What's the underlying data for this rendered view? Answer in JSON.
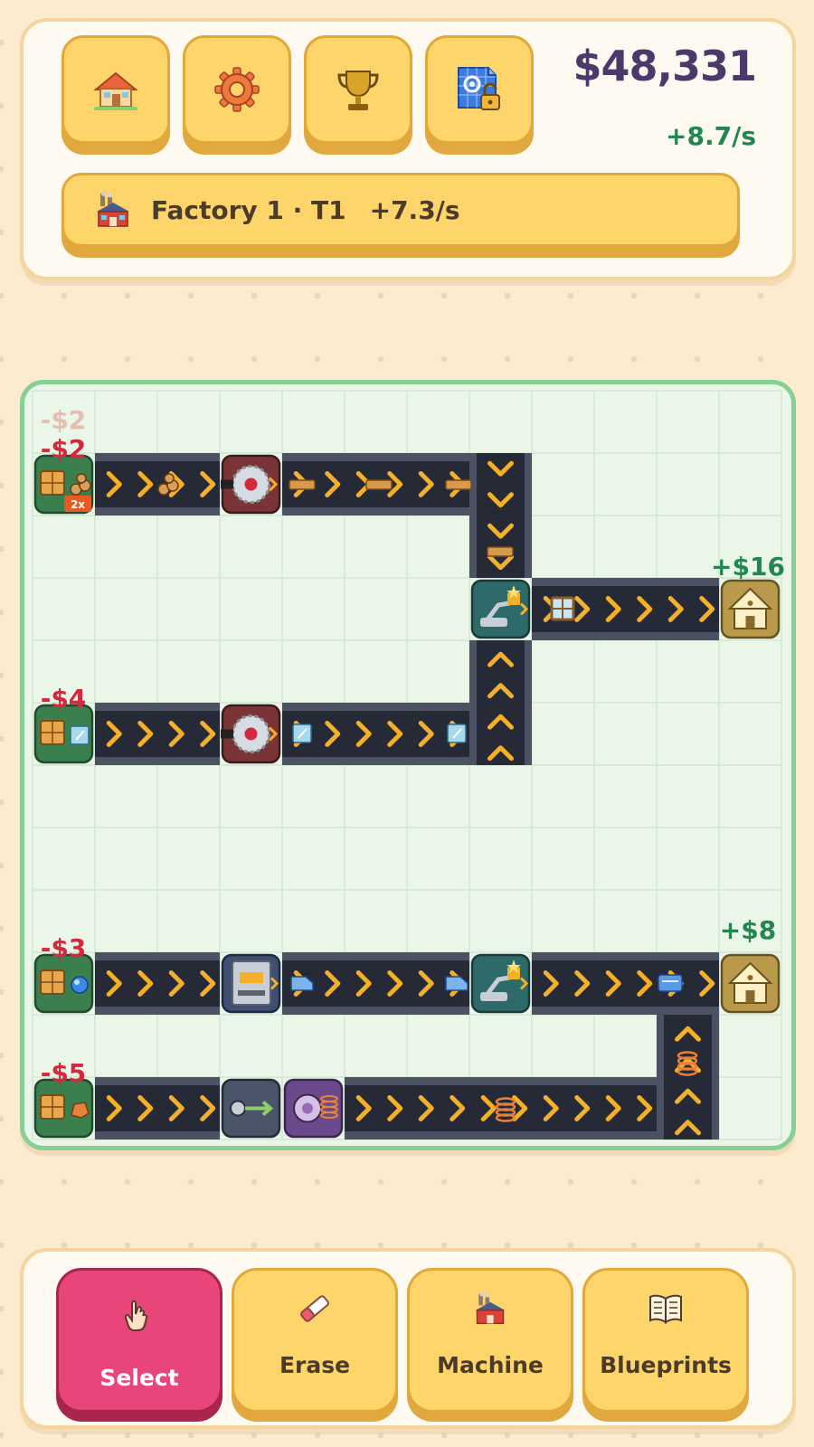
{
  "hud": {
    "buttons": [
      {
        "icon": "house-icon"
      },
      {
        "icon": "gear-icon"
      },
      {
        "icon": "trophy-icon"
      },
      {
        "icon": "blueprint-unlock-icon"
      }
    ],
    "money": "$48,331",
    "rate": "+8.7/s",
    "factory": {
      "name": "Factory 1 · T1",
      "rate": "+7.3/s"
    }
  },
  "board": {
    "floating_costs": [
      {
        "id": "cost-faded",
        "text": "-$2",
        "color": "#e7bdb2"
      },
      {
        "id": "cost-row1",
        "text": "-$2",
        "color": "#d6283c"
      },
      {
        "id": "cost-row2",
        "text": "-$4",
        "color": "#d6283c"
      },
      {
        "id": "cost-row3",
        "text": "-$3",
        "color": "#d6283c"
      },
      {
        "id": "cost-row4",
        "text": "-$5",
        "color": "#d6283c"
      }
    ],
    "incomes": [
      {
        "id": "income-windows",
        "text": "+$16",
        "color": "#22864e"
      },
      {
        "id": "income-cards",
        "text": "+$8",
        "color": "#22864e"
      }
    ],
    "multiplier_badge": "2x"
  },
  "tools": [
    {
      "label": "Select",
      "icon": "pointer-hand-icon",
      "active": true
    },
    {
      "label": "Erase",
      "icon": "eraser-icon",
      "active": false
    },
    {
      "label": "Machine",
      "icon": "factory-icon",
      "active": false
    },
    {
      "label": "Blueprints",
      "icon": "book-icon",
      "active": false
    }
  ],
  "colors": {
    "accent": "#e8457a",
    "button": "#fed56b",
    "board_bg": "#eaf6e7",
    "board_border": "#86cf97",
    "conveyor": "#262a36",
    "chevron": "#f5b02a",
    "money_text": "#4a3a6b",
    "positive": "#22864e",
    "negative": "#d6283c"
  }
}
